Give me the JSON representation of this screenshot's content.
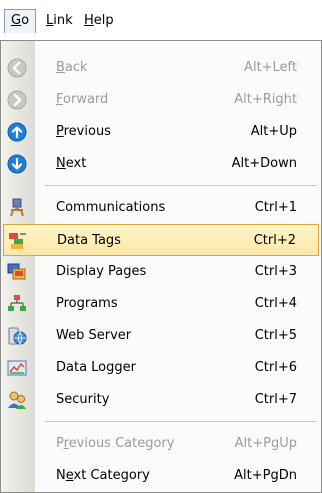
{
  "menubar": {
    "items": [
      {
        "mnemonic": "G",
        "rest": "o"
      },
      {
        "mnemonic": "L",
        "rest": "ink"
      },
      {
        "mnemonic": "H",
        "rest": "elp"
      }
    ]
  },
  "menu": {
    "nav_items": [
      {
        "mnemonic": "B",
        "rest": "ack",
        "shortcut": "Alt+Left",
        "icon": "back-arrow-icon",
        "enabled": false
      },
      {
        "mnemonic": "F",
        "rest": "orward",
        "shortcut": "Alt+Right",
        "icon": "forward-arrow-icon",
        "enabled": false
      },
      {
        "mnemonic": "P",
        "rest": "revious",
        "shortcut": "Alt+Up",
        "icon": "up-arrow-icon",
        "enabled": true
      },
      {
        "mnemonic": "N",
        "rest": "ext",
        "shortcut": "Alt+Down",
        "icon": "down-arrow-icon",
        "enabled": true
      }
    ],
    "category_items": [
      {
        "label": "Communications",
        "shortcut": "Ctrl+1",
        "icon": "communications-icon"
      },
      {
        "label": "Data Tags",
        "shortcut": "Ctrl+2",
        "icon": "data-tags-icon",
        "selected": true
      },
      {
        "label": "Display Pages",
        "shortcut": "Ctrl+3",
        "icon": "display-pages-icon"
      },
      {
        "label": "Programs",
        "shortcut": "Ctrl+4",
        "icon": "programs-icon"
      },
      {
        "label": "Web Server",
        "shortcut": "Ctrl+5",
        "icon": "web-server-icon"
      },
      {
        "label": "Data Logger",
        "shortcut": "Ctrl+6",
        "icon": "data-logger-icon"
      },
      {
        "label": "Security",
        "shortcut": "Ctrl+7",
        "icon": "security-icon"
      }
    ],
    "category_nav": [
      {
        "pre": "P",
        "mnemonic": "r",
        "rest": "evious Category",
        "shortcut": "Alt+PgUp",
        "enabled": false
      },
      {
        "pre": "N",
        "mnemonic": "e",
        "rest": "xt Category",
        "shortcut": "Alt+PgDn",
        "enabled": true
      }
    ]
  },
  "colors": {
    "selection_fill": "#fde8a8",
    "selection_border": "#d9a93f",
    "nav_icon_blue": "#1f7fd8",
    "disabled_text": "#9c9c9c"
  }
}
